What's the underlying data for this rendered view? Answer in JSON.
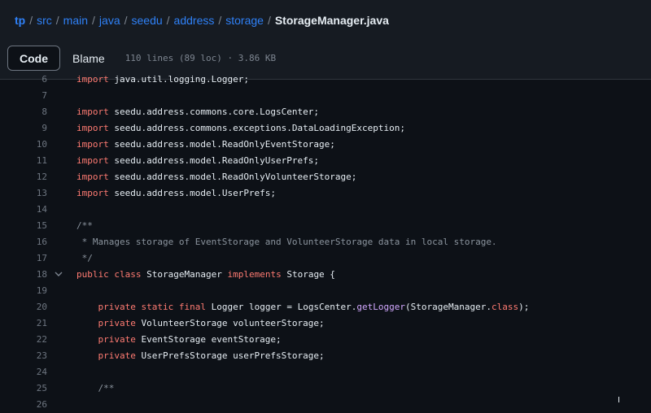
{
  "breadcrumb": {
    "segments": [
      "tp",
      "src",
      "main",
      "java",
      "seedu",
      "address",
      "storage"
    ],
    "separator": "/",
    "file": "StorageManager.java"
  },
  "toolbar": {
    "code_label": "Code",
    "blame_label": "Blame",
    "file_info": "110 lines (89 loc) · 3.86 KB"
  },
  "code_lines": [
    {
      "num": "6",
      "tokens": [
        {
          "t": "import",
          "c": "kw"
        },
        {
          "t": " java.util.logging.Logger;",
          "c": ""
        }
      ]
    },
    {
      "num": "7",
      "tokens": []
    },
    {
      "num": "8",
      "tokens": [
        {
          "t": "import",
          "c": "kw"
        },
        {
          "t": " seedu.address.commons.core.LogsCenter;",
          "c": ""
        }
      ]
    },
    {
      "num": "9",
      "tokens": [
        {
          "t": "import",
          "c": "kw"
        },
        {
          "t": " seedu.address.commons.exceptions.DataLoadingException;",
          "c": ""
        }
      ]
    },
    {
      "num": "10",
      "tokens": [
        {
          "t": "import",
          "c": "kw"
        },
        {
          "t": " seedu.address.model.ReadOnlyEventStorage;",
          "c": ""
        }
      ]
    },
    {
      "num": "11",
      "tokens": [
        {
          "t": "import",
          "c": "kw"
        },
        {
          "t": " seedu.address.model.ReadOnlyUserPrefs;",
          "c": ""
        }
      ]
    },
    {
      "num": "12",
      "tokens": [
        {
          "t": "import",
          "c": "kw"
        },
        {
          "t": " seedu.address.model.ReadOnlyVolunteerStorage;",
          "c": ""
        }
      ]
    },
    {
      "num": "13",
      "tokens": [
        {
          "t": "import",
          "c": "kw"
        },
        {
          "t": " seedu.address.model.UserPrefs;",
          "c": ""
        }
      ]
    },
    {
      "num": "14",
      "tokens": []
    },
    {
      "num": "15",
      "tokens": [
        {
          "t": "/**",
          "c": "cm"
        }
      ]
    },
    {
      "num": "16",
      "tokens": [
        {
          "t": " * Manages storage of EventStorage and VolunteerStorage data in local storage.",
          "c": "cm"
        }
      ]
    },
    {
      "num": "17",
      "tokens": [
        {
          "t": " */",
          "c": "cm"
        }
      ]
    },
    {
      "num": "18",
      "fold": true,
      "tokens": [
        {
          "t": "public",
          "c": "kw"
        },
        {
          "t": " ",
          "c": ""
        },
        {
          "t": "class",
          "c": "kw"
        },
        {
          "t": " StorageManager ",
          "c": ""
        },
        {
          "t": "implements",
          "c": "kw"
        },
        {
          "t": " Storage {",
          "c": ""
        }
      ]
    },
    {
      "num": "19",
      "tokens": []
    },
    {
      "num": "20",
      "tokens": [
        {
          "t": "    ",
          "c": ""
        },
        {
          "t": "private",
          "c": "kw"
        },
        {
          "t": " ",
          "c": ""
        },
        {
          "t": "static",
          "c": "kw"
        },
        {
          "t": " ",
          "c": ""
        },
        {
          "t": "final",
          "c": "kw"
        },
        {
          "t": " Logger logger = LogsCenter.",
          "c": ""
        },
        {
          "t": "getLogger",
          "c": "fn"
        },
        {
          "t": "(StorageManager.",
          "c": ""
        },
        {
          "t": "class",
          "c": "kw"
        },
        {
          "t": ");",
          "c": ""
        }
      ]
    },
    {
      "num": "21",
      "tokens": [
        {
          "t": "    ",
          "c": ""
        },
        {
          "t": "private",
          "c": "kw"
        },
        {
          "t": " VolunteerStorage volunteerStorage;",
          "c": ""
        }
      ]
    },
    {
      "num": "22",
      "tokens": [
        {
          "t": "    ",
          "c": ""
        },
        {
          "t": "private",
          "c": "kw"
        },
        {
          "t": " EventStorage eventStorage;",
          "c": ""
        }
      ]
    },
    {
      "num": "23",
      "tokens": [
        {
          "t": "    ",
          "c": ""
        },
        {
          "t": "private",
          "c": "kw"
        },
        {
          "t": " UserPrefsStorage userPrefsStorage;",
          "c": ""
        }
      ]
    },
    {
      "num": "24",
      "tokens": []
    },
    {
      "num": "25",
      "tokens": [
        {
          "t": "    ",
          "c": ""
        },
        {
          "t": "/**",
          "c": "cm"
        }
      ]
    },
    {
      "num": "26",
      "tokens": []
    }
  ]
}
